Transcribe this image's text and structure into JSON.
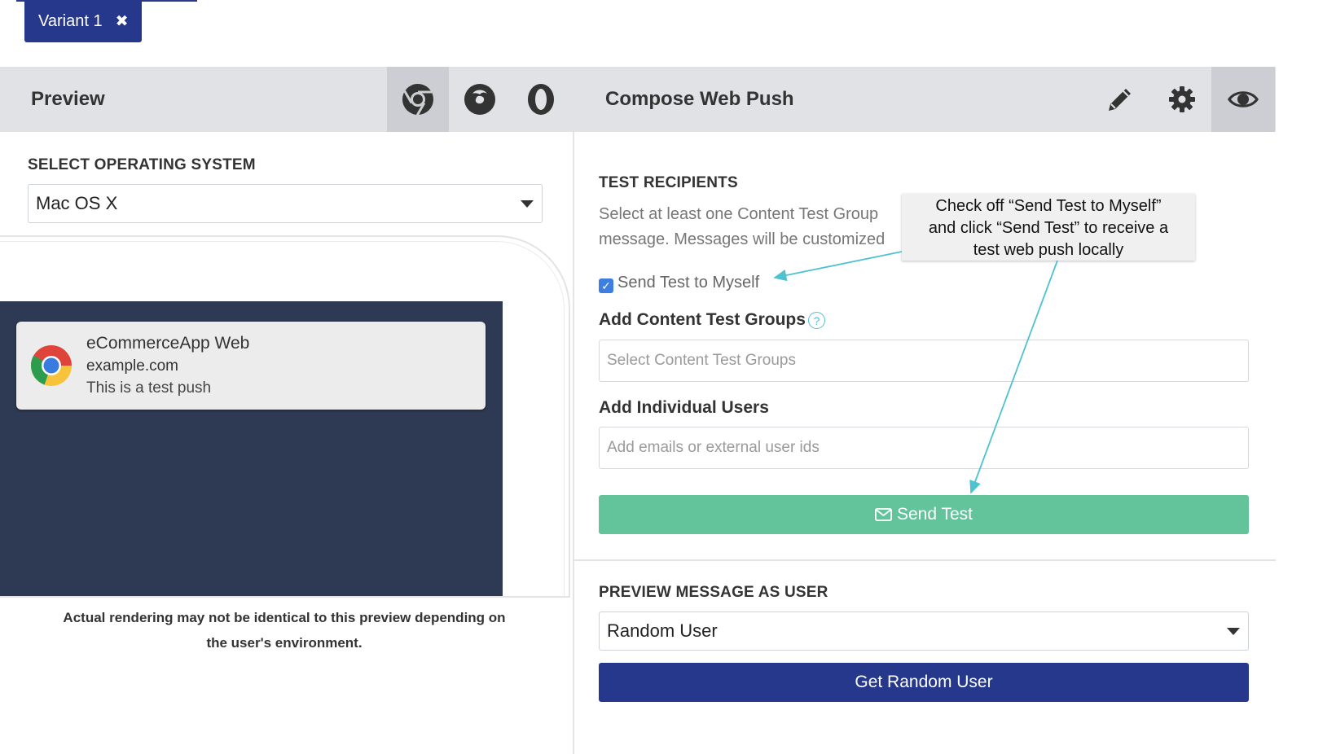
{
  "variant_tab": {
    "label": "Variant 1",
    "close_glyph": "✖"
  },
  "header": {
    "preview_title": "Preview",
    "compose_title": "Compose Web Push",
    "browsers": [
      {
        "name": "chrome-icon",
        "active": true
      },
      {
        "name": "firefox-icon",
        "active": false
      },
      {
        "name": "opera-icon",
        "active": false
      }
    ],
    "tools": [
      {
        "name": "pencil-icon",
        "active": false
      },
      {
        "name": "gear-icon",
        "active": false
      },
      {
        "name": "eye-icon",
        "active": true
      }
    ]
  },
  "preview": {
    "os_label": "SELECT OPERATING SYSTEM",
    "os_value": "Mac OS X",
    "notification": {
      "app_name": "eCommerceApp Web",
      "site": "example.com",
      "body": "This is a test push",
      "icon": "chrome-logo-icon"
    },
    "disclaimer_line1": "Actual rendering may not be identical to this preview depending on",
    "disclaimer_line2": "the user's environment."
  },
  "compose": {
    "test_recipients_label": "TEST RECIPIENTS",
    "description_line1": "Select at least one Content Test Group",
    "description_line2": "message. Messages will be customized",
    "send_to_myself_label": "Send Test to Myself",
    "send_to_myself_checked": true,
    "content_groups_label": "Add Content Test Groups",
    "content_groups_placeholder": "Select Content Test Groups",
    "individual_users_label": "Add Individual Users",
    "individual_users_placeholder": "Add emails or external user ids",
    "send_test_label": "Send Test",
    "preview_as_user_label": "PREVIEW MESSAGE AS USER",
    "preview_user_value": "Random User",
    "get_random_user_label": "Get Random User"
  },
  "callout": {
    "line1": "Check off “Send Test to Myself”",
    "line2": "and click “Send Test” to receive a",
    "line3": "test web push locally"
  },
  "colors": {
    "navy": "#26388c",
    "send_green": "#63c49b",
    "checkbox_blue": "#3d7fe0",
    "callout_line": "#4fc2d0",
    "header_bg": "#e1e2e6",
    "screen_bg": "#2e3a53"
  }
}
